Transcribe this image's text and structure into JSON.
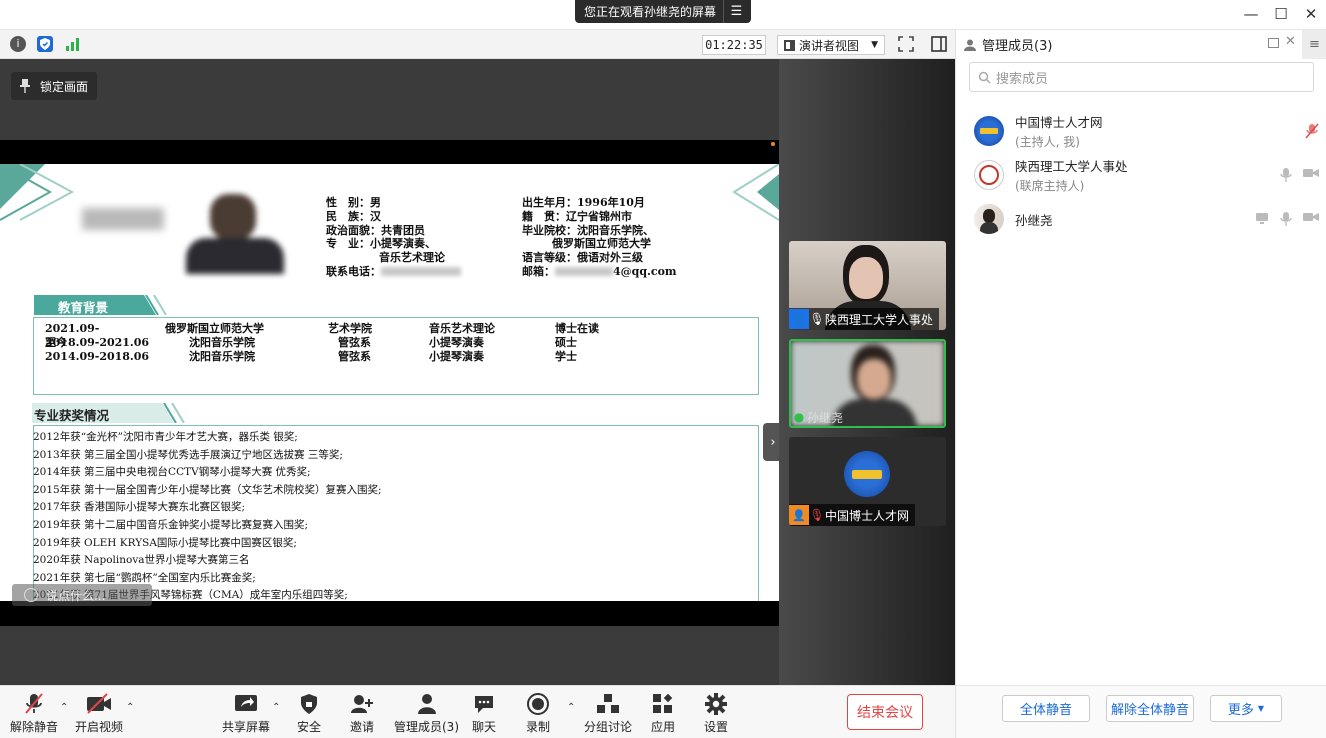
{
  "window": {
    "share_banner": "您正在观看孙继尧的屏幕",
    "banner_menu_icon": "menu-icon"
  },
  "toolbar": {
    "timer": "01:22:35",
    "view_mode": "演讲者视图"
  },
  "stage": {
    "lock_label": "锁定画面",
    "annotation_hint": "说点什么..."
  },
  "slide": {
    "profile": [
      {
        "k": "性　别：",
        "v": "男"
      },
      {
        "k": "民　族：",
        "v": "汉"
      },
      {
        "k": "政治面貌：",
        "v": "共青团员"
      },
      {
        "k": "专　业：",
        "v": "小提琴演奏、"
      },
      {
        "k": "",
        "v": "音乐艺术理论"
      },
      {
        "k": "联系电话：",
        "v": ""
      }
    ],
    "profile_right": [
      {
        "k": "出生年月：",
        "v": "1996年10月"
      },
      {
        "k": "籍　贯：",
        "v": "辽宁省锦州市"
      },
      {
        "k": "毕业院校：",
        "v": "沈阳音乐学院、"
      },
      {
        "k": "",
        "v": "俄罗斯国立师范大学"
      },
      {
        "k": "语言等级：",
        "v": "俄语对外三级"
      },
      {
        "k": "邮箱：",
        "v": "4@qq.com"
      }
    ],
    "edu_title": "教育背景",
    "edu_rows": [
      [
        "2021.09-至今",
        "俄罗斯国立师范大学",
        "艺术学院",
        "音乐艺术理论",
        "博士在读"
      ],
      [
        "2018.09-2021.06",
        "沈阳音乐学院",
        "管弦系",
        "小提琴演奏",
        "硕士"
      ],
      [
        "2014.09-2018.06",
        "沈阳音乐学院",
        "管弦系",
        "小提琴演奏",
        "学士"
      ]
    ],
    "awards_title": "专业获奖情况",
    "awards": [
      "2012年获“金光杯”沈阳市青少年才艺大赛，器乐类 银奖;",
      "2013年获 第三届全国小提琴优秀选手展演辽宁地区选拔赛 三等奖;",
      "2014年获 第三届中央电视台CCTV钢琴小提琴大赛 优秀奖;",
      "2015年获 第十一届全国青少年小提琴比赛（文华艺术院校奖）复赛入围奖;",
      "2017年获 香港国际小提琴大赛东北赛区银奖;",
      "2019年获 第十二届中国音乐金钟奖小提琴比赛复赛入围奖;",
      "2019年获 OLEH KRYSA国际小提琴比赛中国赛区银奖;",
      "2020年获 Napolinova世界小提琴大赛第三名",
      "2021年获 第七届“鹦鹉杯”全国室内乐比赛金奖;",
      "2021年获 第71届世界手风琴锦标赛（CMA）成年室内乐组四等奖;"
    ]
  },
  "gallery": [
    {
      "name": "陕西理工大学人事处",
      "avatar_color": "#1a73e8"
    },
    {
      "name": "孙继尧",
      "avatar_color": "#3bb34a"
    },
    {
      "name": "中国博士人才网",
      "avatar_color": "#f08a24"
    }
  ],
  "controls": {
    "unmute": "解除静音",
    "start_video": "开启视频",
    "share": "共享屏幕",
    "security": "安全",
    "invite": "邀请",
    "members": "管理成员(3)",
    "chat": "聊天",
    "record": "录制",
    "breakout": "分组讨论",
    "apps": "应用",
    "settings": "设置",
    "end": "结束会议"
  },
  "panel": {
    "title": "管理成员(3)",
    "search_placeholder": "搜索成员",
    "members": [
      {
        "name": "中国博士人才网",
        "role": "(主持人, 我)"
      },
      {
        "name": "陕西理工大学人事处",
        "role": "(联席主持人)"
      },
      {
        "name": "孙继尧",
        "role": ""
      }
    ],
    "mute_all": "全体静音",
    "unmute_all": "解除全体静音",
    "more": "更多"
  },
  "colors": {
    "accent": "#1c6bd6",
    "end_red": "#e04646",
    "slide_teal": "#4aa99c"
  }
}
